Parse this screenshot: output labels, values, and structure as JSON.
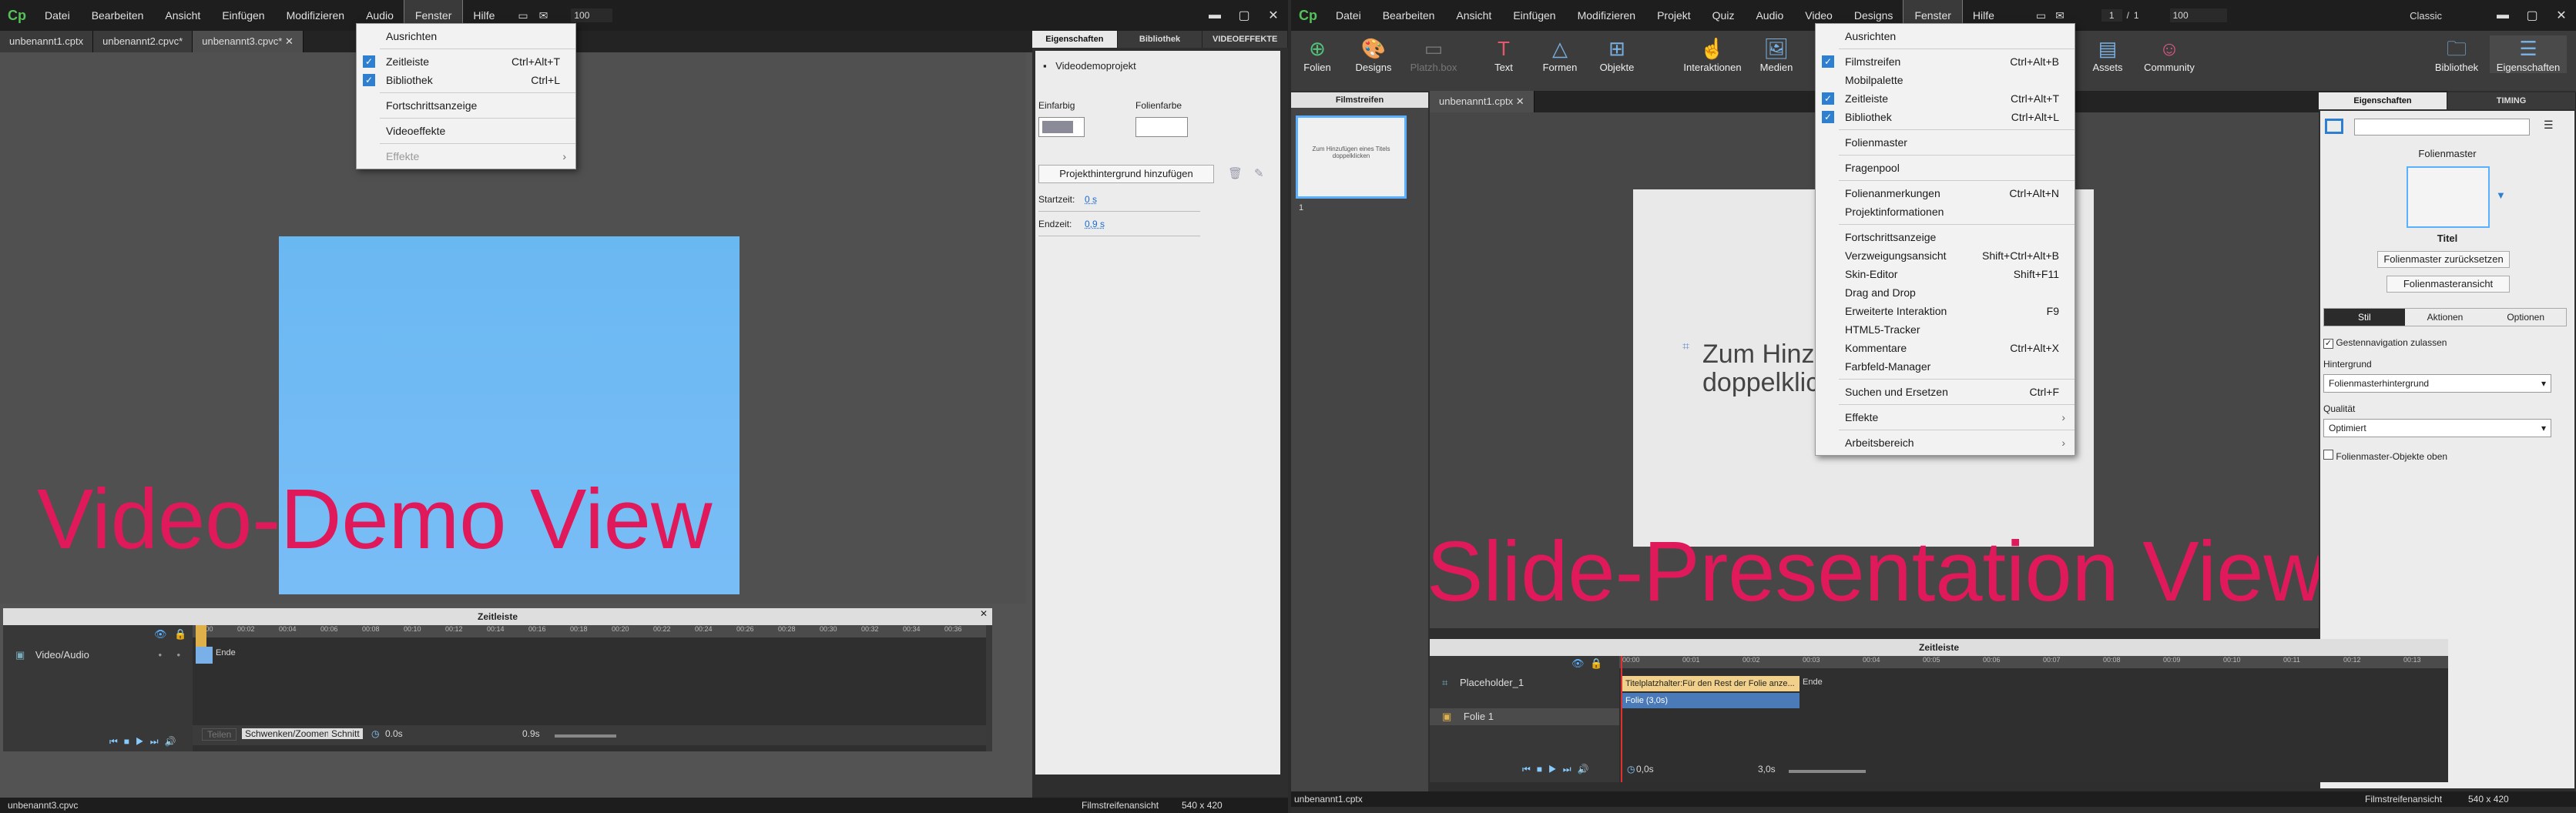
{
  "left": {
    "logo": "Cp",
    "menu": [
      "Datei",
      "Bearbeiten",
      "Ansicht",
      "Einfügen",
      "Modifizieren",
      "Audio",
      "Fenster",
      "Hilfe"
    ],
    "zoom": "100",
    "tabs": [
      "unbenannt1.cptx",
      "unbenannt2.cpvc*",
      "unbenannt3.cpvc*"
    ],
    "fenster_menu": [
      {
        "label": "Ausrichten",
        "shortcut": "",
        "checked": false
      },
      {
        "label": "Zeitleiste",
        "shortcut": "Ctrl+Alt+T",
        "checked": true
      },
      {
        "label": "Bibliothek",
        "shortcut": "Ctrl+L",
        "checked": true
      },
      {
        "label": "Fortschrittsanzeige",
        "shortcut": "",
        "checked": false
      },
      {
        "label": "Videoeffekte",
        "shortcut": "",
        "checked": false
      },
      {
        "label": "Effekte",
        "shortcut": "",
        "checked": false,
        "disabled": true
      }
    ],
    "overlay_text": "Video-Demo View",
    "prop_tabs": [
      "Eigenschaften",
      "Bibliothek",
      "VIDEOEFFEKTE"
    ],
    "project_name": "Videodemoprojekt",
    "einfarbig": "Einfarbig",
    "folienfarbe": "Folienfarbe",
    "bg_button": "Projekthintergrund hinzufügen",
    "startzeit_label": "Startzeit:",
    "startzeit_val": "0 s",
    "endzeit_label": "Endzeit:",
    "endzeit_val": "0,9 s",
    "timeline_title": "Zeitleiste",
    "track": "Video/Audio",
    "ende": "Ende",
    "tl_buttons": [
      "Teilen",
      "Schwenken/Zoomen",
      "Schnitt"
    ],
    "tl_time1": "0.0s",
    "tl_time2": "0.9s",
    "status_file": "unbenannt3.cpvc",
    "status_view": "Filmstreifenansicht",
    "status_size": "540 x 420",
    "ruler_ticks": [
      "00:00",
      "00:02",
      "00:04",
      "00:06",
      "00:08",
      "00:10",
      "00:12",
      "00:14",
      "00:16",
      "00:18",
      "00:20",
      "00:22",
      "00:24",
      "00:26",
      "00:28",
      "00:30",
      "00:32",
      "00:34",
      "00:36"
    ]
  },
  "right": {
    "logo": "Cp",
    "menu": [
      "Datei",
      "Bearbeiten",
      "Ansicht",
      "Einfügen",
      "Modifizieren",
      "Projekt",
      "Quiz",
      "Audio",
      "Video",
      "Designs",
      "Fenster",
      "Hilfe"
    ],
    "slide_num": "1",
    "slide_total": "1",
    "zoom": "100",
    "workspace": "Classic",
    "toolbar": [
      "Folien",
      "Designs",
      "Platzh.box",
      "Text",
      "Formen",
      "Objekte",
      "Interaktionen",
      "Medien"
    ],
    "toolbar_right": [
      "Assets",
      "Community"
    ],
    "toolbar_far": [
      "Bibliothek",
      "Eigenschaften"
    ],
    "filmstrip_title": "Filmstreifen",
    "thumb_text": "Zum Hinzufügen eines Titels doppelklicken",
    "tab": "unbenannt1.cptx",
    "slide_text": "Zum Hinzufügen eines Titels doppelklicken",
    "fenster_menu": [
      {
        "label": "Ausrichten",
        "shortcut": "",
        "checked": false
      },
      {
        "sep": true
      },
      {
        "label": "Filmstreifen",
        "shortcut": "Ctrl+Alt+B",
        "checked": true
      },
      {
        "label": "Mobilpalette",
        "shortcut": "",
        "checked": false
      },
      {
        "label": "Zeitleiste",
        "shortcut": "Ctrl+Alt+T",
        "checked": true
      },
      {
        "label": "Bibliothek",
        "shortcut": "Ctrl+Alt+L",
        "checked": true
      },
      {
        "sep": true
      },
      {
        "label": "Folienmaster",
        "shortcut": "",
        "checked": false
      },
      {
        "sep": true
      },
      {
        "label": "Fragenpool",
        "shortcut": "",
        "checked": false
      },
      {
        "sep": true
      },
      {
        "label": "Folienanmerkungen",
        "shortcut": "Ctrl+Alt+N",
        "checked": false
      },
      {
        "label": "Projektinformationen",
        "shortcut": "",
        "checked": false
      },
      {
        "sep": true
      },
      {
        "label": "Fortschrittsanzeige",
        "shortcut": "",
        "checked": false
      },
      {
        "label": "Verzweigungsansicht",
        "shortcut": "Shift+Ctrl+Alt+B",
        "checked": false
      },
      {
        "label": "Skin-Editor",
        "shortcut": "Shift+F11",
        "checked": false
      },
      {
        "label": "Drag and Drop",
        "shortcut": "",
        "checked": false
      },
      {
        "label": "Erweiterte Interaktion",
        "shortcut": "F9",
        "checked": false
      },
      {
        "label": "HTML5-Tracker",
        "shortcut": "",
        "checked": false
      },
      {
        "label": "Kommentare",
        "shortcut": "Ctrl+Alt+X",
        "checked": false
      },
      {
        "label": "Farbfeld-Manager",
        "shortcut": "",
        "checked": false
      },
      {
        "sep": true
      },
      {
        "label": "Suchen und Ersetzen",
        "shortcut": "Ctrl+F",
        "checked": false
      },
      {
        "sep": true
      },
      {
        "label": "Effekte",
        "shortcut": "",
        "checked": false,
        "submenu": true
      },
      {
        "sep": true
      },
      {
        "label": "Arbeitsbereich",
        "shortcut": "",
        "checked": false,
        "submenu": true
      }
    ],
    "overlay_text": "Slide-Presentation View",
    "prop_tabs": [
      "Eigenschaften",
      "TIMING"
    ],
    "folienmaster": "Folienmaster",
    "titel": "Titel",
    "btn_reset": "Folienmaster zurücksetzen",
    "btn_view": "Folienmasteransicht",
    "sub_tabs": [
      "Stil",
      "Aktionen",
      "Optionen"
    ],
    "gesten": "Gestennavigation zulassen",
    "hintergrund": "Hintergrund",
    "hintergrund_val": "Folienmasterhintergrund",
    "qualitaet": "Qualität",
    "qualitaet_val": "Optimiert",
    "objekte_oben": "Folienmaster-Objekte oben",
    "timeline_title": "Zeitleiste",
    "tracks": [
      "Placeholder_1",
      "Folie 1"
    ],
    "bar1": "Titelplatzhalter:Für den Rest der Folie anze...",
    "bar2": "Folie (3,0s)",
    "ende": "Ende",
    "tl_time1": "0,0s",
    "tl_time2": "3,0s",
    "status_file": "unbenannt1.cptx",
    "status_view": "Filmstreifenansicht",
    "status_size": "540 x 420",
    "ruler_ticks": [
      "00:00",
      "00:01",
      "00:02",
      "00:03",
      "00:04",
      "00:05",
      "00:06",
      "00:07",
      "00:08",
      "00:09",
      "00:10",
      "00:11",
      "00:12",
      "00:13"
    ]
  },
  "colors": {
    "accent": "#e0195a",
    "video_bg": "#6ab8f2",
    "menu_bg": "#f2f2f2",
    "check": "#2f7fd1"
  }
}
